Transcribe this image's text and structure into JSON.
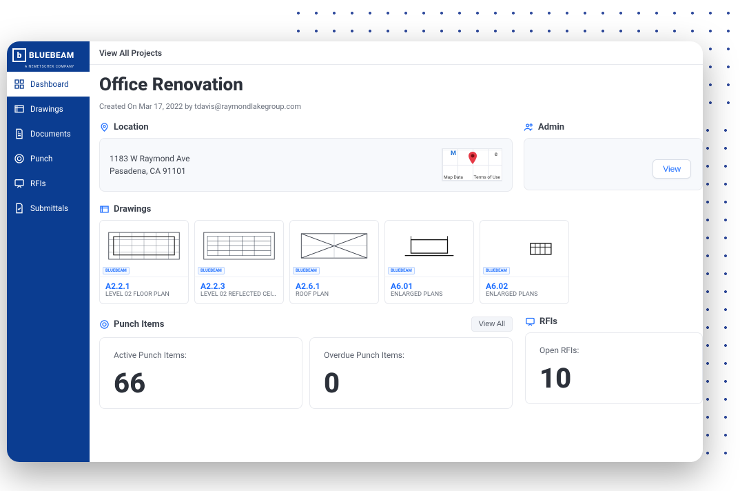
{
  "brand": {
    "name": "BLUEBEAM",
    "sub": "A NEMETSCHEK COMPANY"
  },
  "sidebar": {
    "items": [
      {
        "label": "Dashboard",
        "icon": "dashboard"
      },
      {
        "label": "Drawings",
        "icon": "drawings"
      },
      {
        "label": "Documents",
        "icon": "documents"
      },
      {
        "label": "Punch",
        "icon": "punch"
      },
      {
        "label": "RFIs",
        "icon": "rfis"
      },
      {
        "label": "Submittals",
        "icon": "submittals"
      }
    ],
    "active_index": 0
  },
  "topbar": {
    "view_all": "View All Projects"
  },
  "project": {
    "title": "Office Renovation",
    "created_line": "Created On Mar 17, 2022 by tdavis@raymondlakegroup.com"
  },
  "location": {
    "heading": "Location",
    "address_line1": "1183 W Raymond Ave",
    "address_line2": "Pasadena, CA 91101",
    "map_data_label": "Map Data",
    "terms_label": "Terms of Use"
  },
  "admin": {
    "heading": "Admin",
    "view_label": "View"
  },
  "drawings": {
    "heading": "Drawings",
    "thumb_brand": "BLUEBEAM",
    "items": [
      {
        "code": "A2.2.1",
        "title": "LEVEL 02 FLOOR PLAN"
      },
      {
        "code": "A2.2.3",
        "title": "LEVEL 02 REFLECTED CEIL..."
      },
      {
        "code": "A2.6.1",
        "title": "ROOF PLAN"
      },
      {
        "code": "A6.01",
        "title": "ENLARGED PLANS"
      },
      {
        "code": "A6.02",
        "title": "ENLARGED PLANS"
      }
    ]
  },
  "punch": {
    "heading": "Punch Items",
    "view_all": "View All",
    "stats": [
      {
        "label": "Active Punch Items:",
        "value": "66"
      },
      {
        "label": "Overdue Punch Items:",
        "value": "0"
      }
    ]
  },
  "rfis": {
    "heading": "RFIs",
    "stat": {
      "label": "Open RFIs:",
      "value": "10"
    }
  }
}
